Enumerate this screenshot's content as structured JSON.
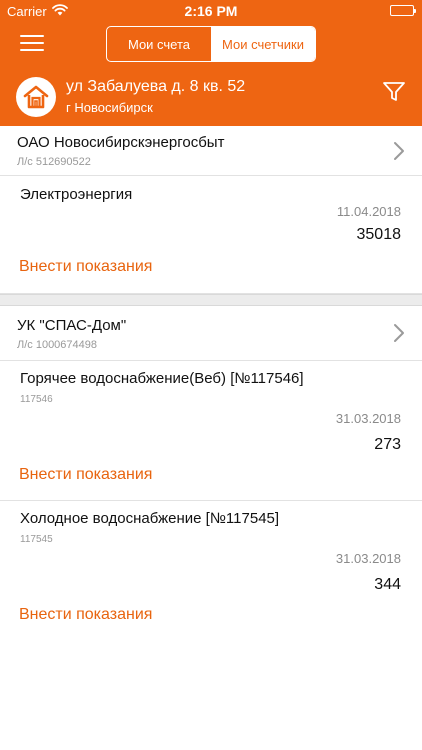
{
  "status_bar": {
    "carrier": "Carrier",
    "time": "2:16 PM",
    "wifi_icon": "wifi-icon",
    "battery_icon": "battery-icon"
  },
  "nav": {
    "menu_icon": "hamburger-menu-icon",
    "tabs": [
      {
        "label": "Мои счета",
        "selected": false
      },
      {
        "label": "Мои счетчики",
        "selected": true
      }
    ]
  },
  "address": {
    "logo_icon": "house-logo-icon",
    "line1": "ул Забалуева д. 8 кв. 52",
    "line2": "г Новосибирск",
    "filter_icon": "filter-icon"
  },
  "providers": [
    {
      "name": "ОАО Новосибирскэнергосбыт",
      "account": "Л/с 512690522",
      "meters": [
        {
          "name": "Электроэнергия",
          "serial": "",
          "date": "11.04.2018",
          "value": "35018",
          "action": "Внести показания"
        }
      ]
    },
    {
      "name": "УК \"СПАС-Дом\"",
      "account": "Л/с 1000674498",
      "meters": [
        {
          "name": "Горячее водоснабжение(Веб)  [№117546]",
          "serial": "117546",
          "date": "31.03.2018",
          "value": "273",
          "action": "Внести показания"
        },
        {
          "name": "Холодное водоснабжение  [№117545]",
          "serial": "117545",
          "date": "31.03.2018",
          "value": "344",
          "action": "Внести показания"
        }
      ]
    }
  ],
  "colors": {
    "accent": "#ee6512",
    "link": "#e8640f",
    "muted": "#999999",
    "separator": "#e2e2e2"
  }
}
